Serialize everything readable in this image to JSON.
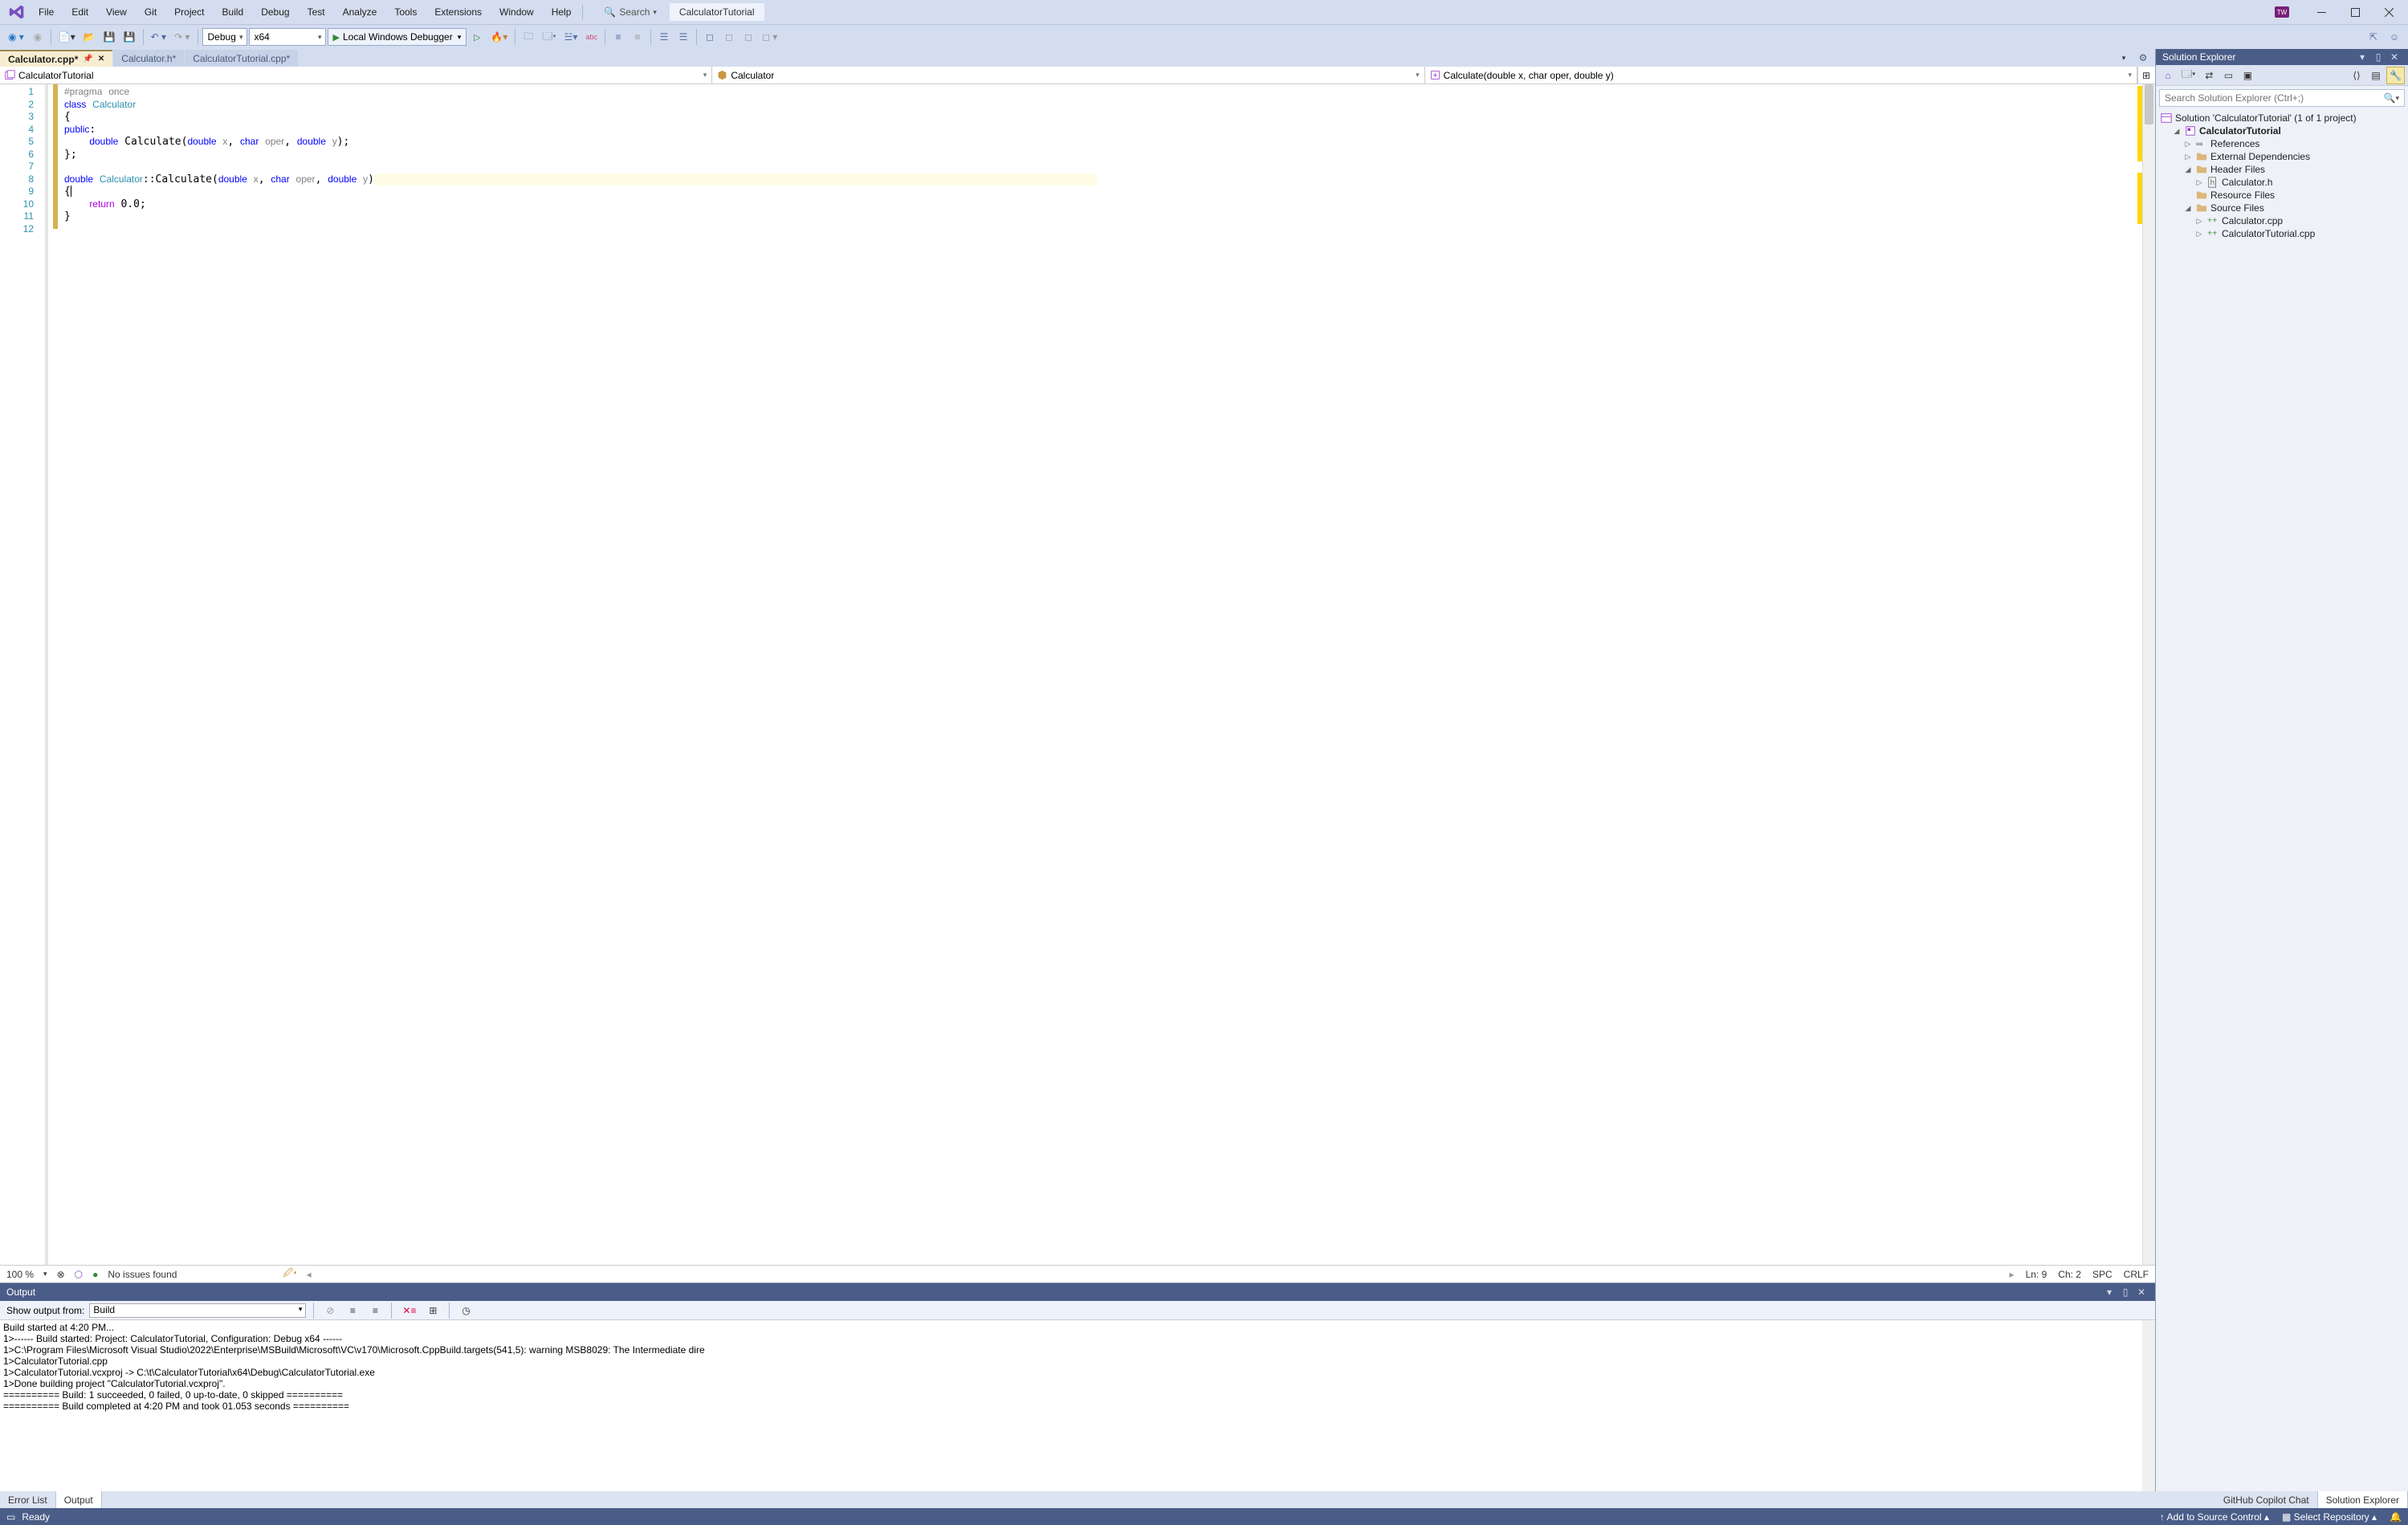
{
  "menu": [
    "File",
    "Edit",
    "View",
    "Git",
    "Project",
    "Build",
    "Debug",
    "Test",
    "Analyze",
    "Tools",
    "Extensions",
    "Window",
    "Help"
  ],
  "title_search": "Search",
  "window_title": "CalculatorTutorial",
  "toolbar": {
    "config": "Debug",
    "platform": "x64",
    "debugger": "Local Windows Debugger"
  },
  "tabs": [
    {
      "label": "Calculator.cpp*",
      "active": true
    },
    {
      "label": "Calculator.h*",
      "active": false
    },
    {
      "label": "CalculatorTutorial.cpp*",
      "active": false
    }
  ],
  "context": {
    "scope": "CalculatorTutorial",
    "class": "Calculator",
    "member": "Calculate(double x, char oper, double y)"
  },
  "code_lines": [
    "1",
    "2",
    "3",
    "4",
    "5",
    "6",
    "7",
    "8",
    "9",
    "10",
    "11",
    "12"
  ],
  "editor_status": {
    "zoom": "100 %",
    "issues": "No issues found",
    "ln": "Ln: 9",
    "ch": "Ch: 2",
    "spc": "SPC",
    "crlf": "CRLF"
  },
  "output": {
    "title": "Output",
    "show_label": "Show output from:",
    "source": "Build",
    "text": "Build started at 4:20 PM...\n1>------ Build started: Project: CalculatorTutorial, Configuration: Debug x64 ------\n1>C:\\Program Files\\Microsoft Visual Studio\\2022\\Enterprise\\MSBuild\\Microsoft\\VC\\v170\\Microsoft.CppBuild.targets(541,5): warning MSB8029: The Intermediate dire\n1>CalculatorTutorial.cpp\n1>CalculatorTutorial.vcxproj -> C:\\t\\CalculatorTutorial\\x64\\Debug\\CalculatorTutorial.exe\n1>Done building project \"CalculatorTutorial.vcxproj\".\n========== Build: 1 succeeded, 0 failed, 0 up-to-date, 0 skipped ==========\n========== Build completed at 4:20 PM and took 01.053 seconds =========="
  },
  "solution": {
    "title": "Solution Explorer",
    "search_placeholder": "Search Solution Explorer (Ctrl+;)",
    "root": "Solution 'CalculatorTutorial' (1 of 1 project)",
    "project": "CalculatorTutorial",
    "nodes": {
      "refs": "References",
      "ext": "External Dependencies",
      "headers": "Header Files",
      "calc_h": "Calculator.h",
      "res": "Resource Files",
      "src": "Source Files",
      "calc_cpp": "Calculator.cpp",
      "tut_cpp": "CalculatorTutorial.cpp"
    }
  },
  "bottom_left_tabs": [
    "Error List",
    "Output"
  ],
  "bottom_right_tabs": [
    "GitHub Copilot Chat",
    "Solution Explorer"
  ],
  "status": {
    "ready": "Ready",
    "src_ctrl": "Add to Source Control",
    "repo": "Select Repository"
  }
}
